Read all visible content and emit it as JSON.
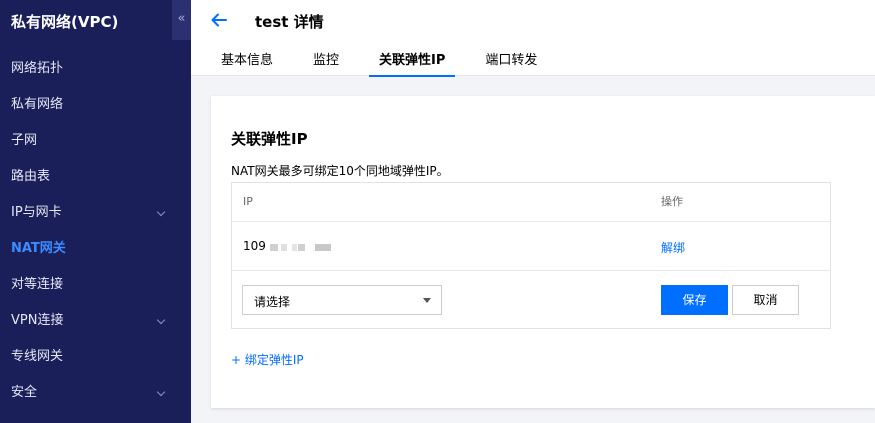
{
  "sidebar": {
    "title": "私有网络(VPC)",
    "collapse_glyph": "«",
    "items": [
      {
        "label": "网络拓扑"
      },
      {
        "label": "私有网络"
      },
      {
        "label": "子网"
      },
      {
        "label": "路由表"
      },
      {
        "label": "IP与网卡",
        "expandable": true
      },
      {
        "label": "NAT网关",
        "active": true
      },
      {
        "label": "对等连接"
      },
      {
        "label": "VPN连接",
        "expandable": true
      },
      {
        "label": "专线网关"
      },
      {
        "label": "安全",
        "expandable": true
      }
    ]
  },
  "header": {
    "title": "test 详情",
    "tabs": [
      {
        "label": "基本信息"
      },
      {
        "label": "监控"
      },
      {
        "label": "关联弹性IP",
        "active": true
      },
      {
        "label": "端口转发"
      }
    ]
  },
  "card": {
    "title": "关联弹性IP",
    "description": "NAT网关最多可绑定10个同地域弹性IP。",
    "table": {
      "columns": [
        "IP",
        "操作"
      ],
      "rows": [
        {
          "ip": "109",
          "action": "解绑"
        }
      ]
    },
    "edit_row": {
      "select_placeholder": "请选择",
      "save_label": "保存",
      "cancel_label": "取消"
    },
    "add_link": "+ 绑定弹性IP"
  },
  "colors": {
    "sidebar_bg": "#1a1f5a",
    "accent": "#006eff",
    "active_nav": "#3c8cff"
  }
}
